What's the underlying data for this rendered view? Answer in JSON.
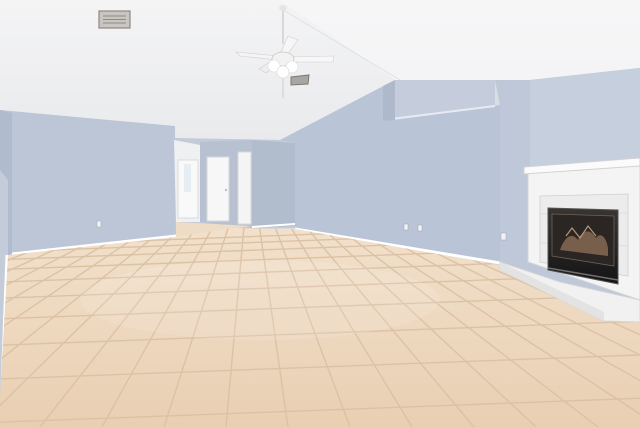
{
  "scene": {
    "description_label": "",
    "palette": {
      "ceiling": "#f1f1f2",
      "wall_blue": "#b8c3d6",
      "wall_blue_light": "#c7cfdd",
      "floor_tile": "#edd7bf",
      "grout": "#d9bfa3",
      "baseboard": "#ffffff",
      "fireplace_surround": "#f4f4f4",
      "firebox": "#232325",
      "door": "#f7f7f7"
    },
    "objects": [
      {
        "id": "ceiling",
        "kind": "vaulted-ceiling"
      },
      {
        "id": "ceiling-fan",
        "kind": "ceiling-fan-with-light"
      },
      {
        "id": "ac-vent-left",
        "kind": "hvac-vent"
      },
      {
        "id": "ac-vent-center",
        "kind": "hvac-vent"
      },
      {
        "id": "left-wall",
        "kind": "wall"
      },
      {
        "id": "back-wall",
        "kind": "wall"
      },
      {
        "id": "right-wall",
        "kind": "wall"
      },
      {
        "id": "hallway",
        "kind": "hallway-with-doors"
      },
      {
        "id": "plant-shelf",
        "kind": "recessed-ledge"
      },
      {
        "id": "fireplace",
        "kind": "fireplace-with-tile-surround"
      },
      {
        "id": "tile-floor",
        "kind": "ceramic-tile-floor"
      },
      {
        "id": "outlets",
        "kind": "wall-outlets"
      }
    ]
  }
}
